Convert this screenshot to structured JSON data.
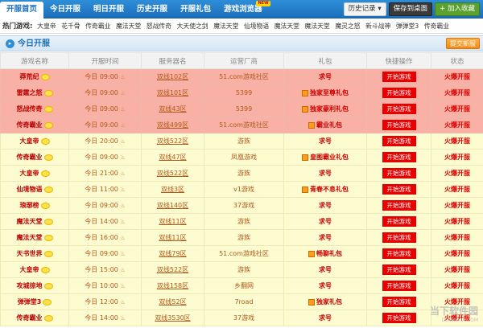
{
  "nav": {
    "tabs": [
      "开服首页",
      "今日开服",
      "明日开服",
      "历史开服",
      "开服礼包",
      "游戏浏览器"
    ],
    "new_badge": "NEW",
    "history_label": "历史记录 ▾",
    "save_label": "保存到桌面",
    "fav_label": "+ 加入收藏"
  },
  "hot": {
    "label": "热门游戏:",
    "games": [
      "大皇帝",
      "花千骨",
      "传奇霸业",
      "魔法天堂",
      "怒战传奇",
      "大天使之剑",
      "魔法天堂",
      "仙境物语",
      "魔法天堂",
      "魔法天堂",
      "魔灵之怒",
      "新斗战神",
      "弹弹堂3",
      "传奇霸业"
    ]
  },
  "section": {
    "icon": "▸",
    "title": "今日开服",
    "submit_label": "提交新服"
  },
  "table": {
    "headers": [
      "游戏名称",
      "开服时间",
      "服务器名",
      "运营厂商",
      "礼包",
      "快捷操作",
      "状态"
    ],
    "play_label": "开始游戏",
    "rows": [
      {
        "type": "hot",
        "name": "莽荒纪",
        "time": "今日 09:00",
        "server": "双线102区",
        "operator": "51.com游戏社区",
        "gift": "求号",
        "gift_icon": false,
        "status": "火爆开服"
      },
      {
        "type": "hot",
        "name": "雷霆之怒",
        "time": "今日 09:00",
        "server": "双线101区",
        "operator": "5399",
        "gift": "独家至尊礼包",
        "gift_icon": true,
        "status": "火爆开服"
      },
      {
        "type": "hot",
        "name": "怒战传奇",
        "time": "今日 09:00",
        "server": "双线43区",
        "operator": "5399",
        "gift": "独家豪利礼包",
        "gift_icon": true,
        "status": "火爆开服"
      },
      {
        "type": "hot",
        "name": "传奇霸业",
        "time": "今日 09:00",
        "server": "双线499区",
        "operator": "51.com游戏社区",
        "gift": "霸业礼包",
        "gift_icon": true,
        "status": "火爆开服"
      },
      {
        "type": "normal",
        "name": "大皇帝",
        "time": "今日 20:00",
        "server": "双线522区",
        "operator": "游族",
        "gift": "求号",
        "gift_icon": false,
        "status": "火爆开服"
      },
      {
        "type": "normal",
        "name": "传奇霸业",
        "time": "今日 09:00",
        "server": "双线47区",
        "operator": "凤凰游戏",
        "gift": "皇图霸业礼包",
        "gift_icon": true,
        "status": "火爆开服"
      },
      {
        "type": "normal",
        "name": "大皇帝",
        "time": "今日 21:00",
        "server": "双线522区",
        "operator": "游族",
        "gift": "求号",
        "gift_icon": false,
        "status": "火爆开服"
      },
      {
        "type": "normal",
        "name": "仙境物语",
        "time": "今日 11:00",
        "server": "双线3区",
        "operator": "v1游戏",
        "gift": "青春不息礼包",
        "gift_icon": true,
        "status": "火爆开服"
      },
      {
        "type": "normal",
        "name": "琅琊榜",
        "time": "今日 09:00",
        "server": "双线140区",
        "operator": "37游戏",
        "gift": "求号",
        "gift_icon": false,
        "status": "火爆开服"
      },
      {
        "type": "normal",
        "name": "魔法天堂",
        "time": "今日 14:00",
        "server": "双线11区",
        "operator": "游族",
        "gift": "求号",
        "gift_icon": false,
        "status": "火爆开服"
      },
      {
        "type": "normal",
        "name": "魔法天堂",
        "time": "今日 16:00",
        "server": "双线11区",
        "operator": "游族",
        "gift": "求号",
        "gift_icon": false,
        "status": "火爆开服"
      },
      {
        "type": "normal",
        "name": "天书世界",
        "time": "今日 09:00",
        "server": "双线79区",
        "operator": "51.com游戏社区",
        "gift": "畅聊礼包",
        "gift_icon": true,
        "status": "火爆开服"
      },
      {
        "type": "normal",
        "name": "大皇帝",
        "time": "今日 15:00",
        "server": "双线522区",
        "operator": "游族",
        "gift": "求号",
        "gift_icon": false,
        "status": "火爆开服"
      },
      {
        "type": "normal",
        "name": "攻城掠地",
        "time": "今日 10:00",
        "server": "双线158区",
        "operator": "乡翻网",
        "gift": "求号",
        "gift_icon": false,
        "status": "火爆开服"
      },
      {
        "type": "normal",
        "name": "弹弹堂3",
        "time": "今日 12:00",
        "server": "双线52区",
        "operator": "7road",
        "gift": "独家礼包",
        "gift_icon": true,
        "status": "火爆开服"
      },
      {
        "type": "normal",
        "name": "传奇霸业",
        "time": "今日 14:00",
        "server": "双线3530区",
        "operator": "37游戏",
        "gift": "求号",
        "gift_icon": false,
        "status": "火爆开服"
      }
    ]
  },
  "watermark": {
    "text": "当下软件园",
    "sub": "DOWNXIA.COM"
  },
  "colors": {
    "nav": "#1a6fbb",
    "hot_row": "#f8b1a4",
    "normal_row": "#fdfbd0",
    "status": "#e00000",
    "play": "#e80000"
  }
}
